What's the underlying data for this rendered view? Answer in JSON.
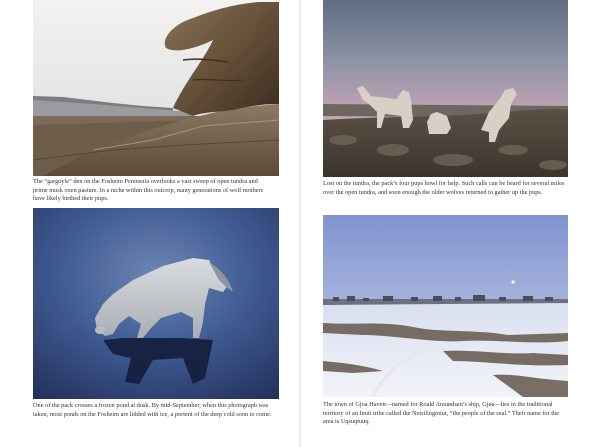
{
  "photos": {
    "top_left": {
      "caption": "The “gargoyle” den on the Fosheim Peninsula overlooks a vast sweep of open tundra and prime musk oxen pasture. In a niche within this outcrop, many generations of wolf mothers have likely birthed their pups."
    },
    "top_right": {
      "caption": "Lost on the tundra, the pack’s four pups howl for help. Such calls can be heard for several miles over the open tundra, and soon enough the older wolves returned to gather up the pups."
    },
    "bottom_left": {
      "caption": "One of the pack crosses a frozen pond at dusk. By mid-September, when this photograph was taken, most ponds on the Fosheim are lidded with ice, a portent of the deep cold soon to come."
    },
    "bottom_right": {
      "caption": "The town of Gjoa Haven—named for Roald Amundsen’s ship, Gjøa—lies in the traditional territory of an Inuit tribe called the Netsilingmiut, “the people of the seal.” Their name for the area is Uqsuqtuuq."
    }
  },
  "colors": {
    "page": "#ffffff",
    "caption_text": "#333333",
    "dusk_blue": "#2e3f72",
    "sunset_pink": "#cfa2b8",
    "snow": "#e9eef6"
  }
}
